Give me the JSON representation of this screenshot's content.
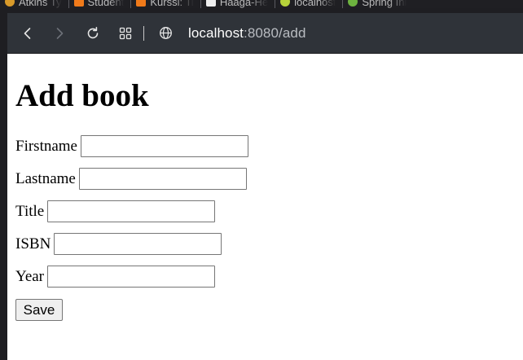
{
  "bookmarks": [
    {
      "label": "Atkins Ty",
      "icon": "atkins-favicon",
      "color": "#d89a2a"
    },
    {
      "label": "Student",
      "icon": "moodle-favicon",
      "color": "#f07a1a"
    },
    {
      "label": "Kurssi: Ti",
      "icon": "moodle-favicon",
      "color": "#f07a1a"
    },
    {
      "label": "Haaga-He",
      "icon": "page-favicon",
      "color": "#eeeeee"
    },
    {
      "label": "localhost",
      "icon": "spring-favicon",
      "color": "#b6d33a"
    },
    {
      "label": "Spring Ini",
      "icon": "spring-favicon",
      "color": "#6db33f"
    }
  ],
  "toolbar": {
    "url_host": "localhost",
    "url_path": ":8080/add"
  },
  "page": {
    "heading": "Add book",
    "fields": {
      "firstname": {
        "label": "Firstname",
        "value": ""
      },
      "lastname": {
        "label": "Lastname",
        "value": ""
      },
      "title": {
        "label": "Title",
        "value": ""
      },
      "isbn": {
        "label": "ISBN",
        "value": ""
      },
      "year": {
        "label": "Year",
        "value": ""
      }
    },
    "save_label": "Save"
  }
}
